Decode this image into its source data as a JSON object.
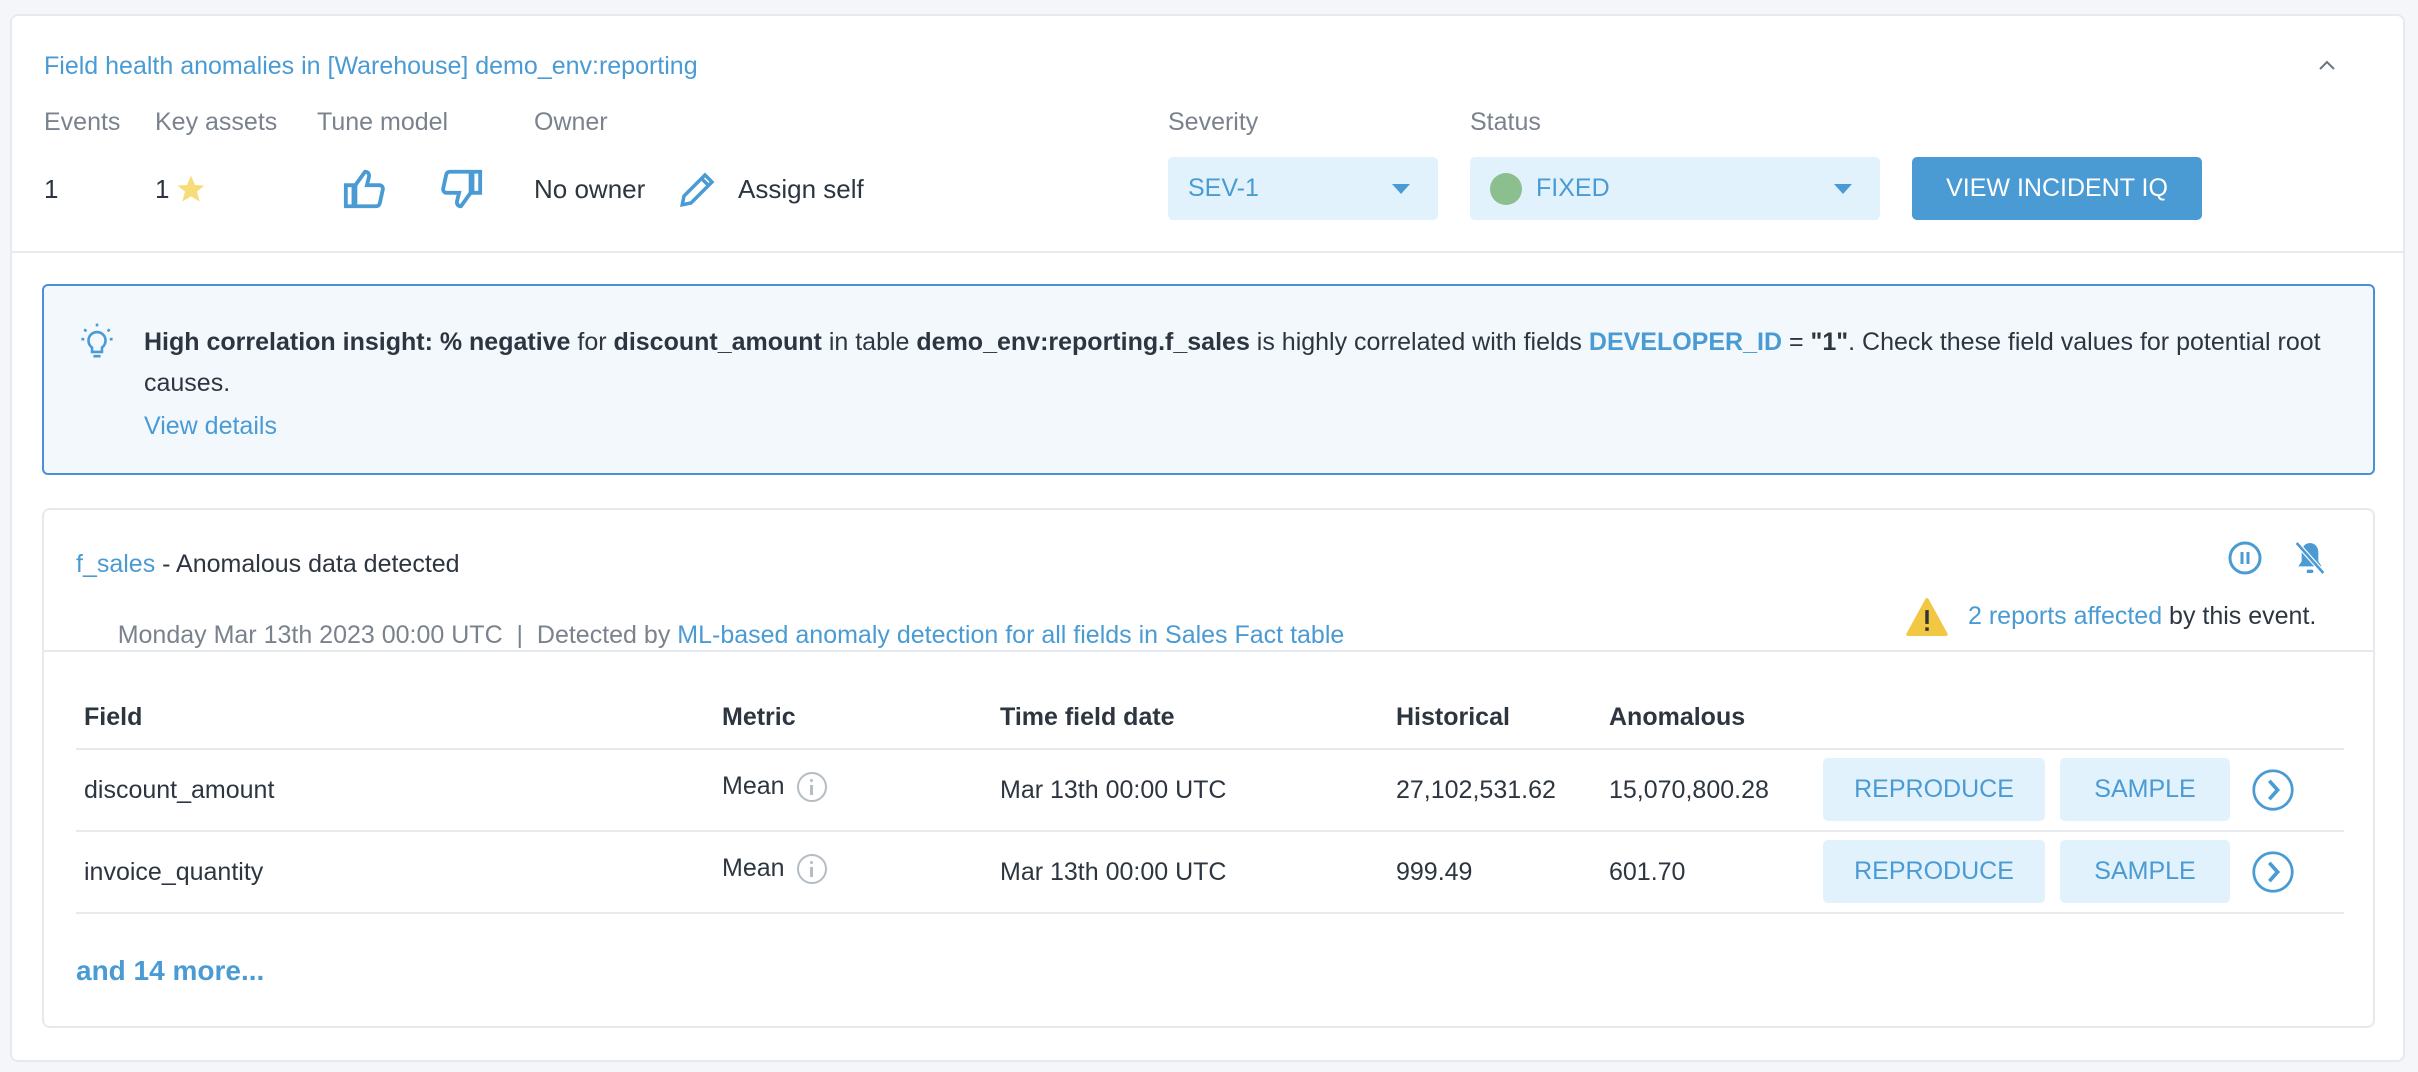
{
  "header": {
    "title": "Field health anomalies in [Warehouse] demo_env:reporting",
    "collapse_icon": "chevron-up-icon",
    "labels": {
      "events": "Events",
      "key_assets": "Key assets",
      "tune_model": "Tune model",
      "owner": "Owner",
      "severity": "Severity",
      "status": "Status"
    },
    "events_count": "1",
    "key_assets_count": "1",
    "key_asset_icon": "star-icon",
    "tune_icons": [
      "thumbs-up-icon",
      "thumbs-down-icon"
    ],
    "owner_value": "No owner",
    "assign_self": "Assign self",
    "severity_value": "SEV-1",
    "status_value": "FIXED",
    "status_color": "#8bbf8e",
    "view_incident_iq": "VIEW INCIDENT IQ"
  },
  "insight": {
    "icon": "lightbulb-icon",
    "lead": "High correlation insight:",
    "metric": "% negative",
    "t1": " for ",
    "field": "discount_amount",
    "t2": " in table ",
    "table": "demo_env:reporting.f_sales",
    "t3": " is highly correlated with fields ",
    "corr_field": "DEVELOPER_ID",
    "eq": " = ",
    "corr_value": "\"1\"",
    "t4": ". Check these field values for potential root causes.",
    "view_details": "View details"
  },
  "event": {
    "table_link": "f_sales",
    "title_suffix": " - Anomalous data detected",
    "date": "Monday Mar 13th 2023 00:00 UTC",
    "detected_by_prefix": "  |  Detected by ",
    "detector_link": "ML-based anomaly detection for all fields in Sales Fact table",
    "reports_link": "2 reports affected",
    "reports_suffix": " by this event.",
    "icons": [
      "pause-circle-icon",
      "bell-off-icon",
      "warning-icon"
    ],
    "table": {
      "columns": [
        "Field",
        "Metric",
        "Time field date",
        "Historical",
        "Anomalous"
      ],
      "rows": [
        {
          "field": "discount_amount",
          "metric": "Mean",
          "time": "Mar 13th 00:00 UTC",
          "historical": "27,102,531.62",
          "anomalous": "15,070,800.28",
          "reproduce": "REPRODUCE",
          "sample": "SAMPLE"
        },
        {
          "field": "invoice_quantity",
          "metric": "Mean",
          "time": "Mar 13th 00:00 UTC",
          "historical": "999.49",
          "anomalous": "601.70",
          "reproduce": "REPRODUCE",
          "sample": "SAMPLE"
        }
      ]
    },
    "more_link": "and 14 more..."
  },
  "colors": {
    "accent": "#4a9bd4",
    "status_fixed": "#8bbf8e",
    "warning": "#f2c744",
    "star": "#f7dc7a"
  }
}
